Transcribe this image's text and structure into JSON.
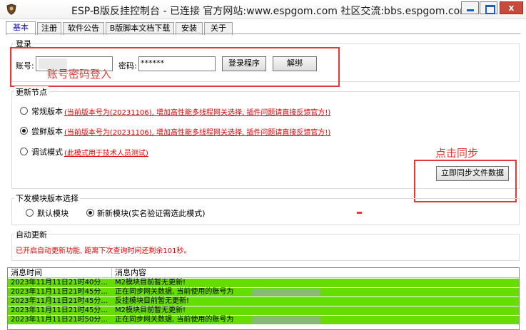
{
  "window": {
    "title": "ESP-B版反挂控制台 - 已连接  官方网站:www.espgom.com 社区交流:bbs.espgom.com",
    "close_glyph": "x"
  },
  "tabs": [
    "基本",
    "注册",
    "软件公告",
    "B版脚本文档下载",
    "安装",
    "关于"
  ],
  "login": {
    "group_label": "登录",
    "account_label": "账号:",
    "account_value": "",
    "password_label": "密码:",
    "password_value": "******",
    "login_button": "登录程序",
    "unbind_button": "解绑",
    "annotation": "账号密码登入"
  },
  "update_node": {
    "group_label": "更新节点",
    "options": [
      {
        "label": "常规版本",
        "note": "(当前版本号为(20231106), 增加高性能多线程网关选择, 插件问题请直接反馈官方!)",
        "selected": false
      },
      {
        "label": "尝鲜版本",
        "note": "(当前版本号为(20231106), 增加高性能多线程网关选择, 插件问题请直接反馈官方!)",
        "selected": true
      },
      {
        "label": "调试模式",
        "note": "(此模式用于技术人员测试)",
        "selected": false
      }
    ],
    "sync_button": "立即同步文件数据",
    "annotation": "点击同步"
  },
  "module": {
    "group_label": "下发模块版本选择",
    "options": [
      {
        "label": "默认模块",
        "selected": false
      },
      {
        "label": "新新模块(实名验证需选此模式)",
        "selected": true
      }
    ]
  },
  "auto_update": {
    "group_label": "自动更新",
    "status": "已开启自动更新功能, 距离下次查询时间还剩余101秒。"
  },
  "log": {
    "col_time": "消息时间",
    "col_content": "消息内容",
    "rows": [
      {
        "time": "2023年11月11日21时40分...",
        "content": "M2模块目前暂无更新!"
      },
      {
        "time": "2023年11月11日21时45分...",
        "content": "正在同步网关数据, 当前使用的账号为"
      },
      {
        "time": "2023年11月11日21时45分...",
        "content": "反挂模块目前暂无更新!"
      },
      {
        "time": "2023年11月11日21时45分...",
        "content": "M2模块目前暂无更新!"
      },
      {
        "time": "2023年11月11日21时50分...",
        "content": "正在同步网关数据, 当前使用的账号为"
      }
    ]
  },
  "colors": {
    "annotation_red": "#e53935",
    "log_row_green": "#66dd00",
    "note_red": "#e00000"
  }
}
